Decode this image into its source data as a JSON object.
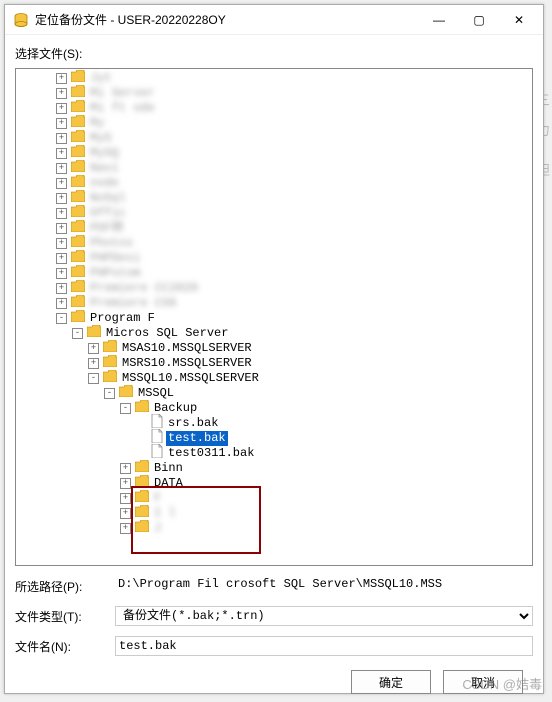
{
  "window": {
    "title": "定位备份文件 - USER-20220228OY",
    "min": "—",
    "max": "▢",
    "close": "✕"
  },
  "labels": {
    "select_file": "选择文件(S):",
    "selected_path": "所选路径(P):",
    "file_type": "文件类型(T):",
    "file_name": "文件名(N):"
  },
  "tree": [
    {
      "indent": 40,
      "exp": "+",
      "type": "folder",
      "label": "Jyt",
      "blur": true
    },
    {
      "indent": 40,
      "exp": "+",
      "type": "folder",
      "label": "Mi         Server",
      "blur": true
    },
    {
      "indent": 40,
      "exp": "+",
      "type": "folder",
      "label": "Mi   ft     ode",
      "blur": true
    },
    {
      "indent": 40,
      "exp": "+",
      "type": "folder",
      "label": "My",
      "blur": true
    },
    {
      "indent": 40,
      "exp": "+",
      "type": "folder",
      "label": "MyS",
      "blur": true
    },
    {
      "indent": 40,
      "exp": "+",
      "type": "folder",
      "label": "MySQ",
      "blur": true
    },
    {
      "indent": 40,
      "exp": "+",
      "type": "folder",
      "label": "Navi",
      "blur": true
    },
    {
      "indent": 40,
      "exp": "+",
      "type": "folder",
      "label": "node",
      "blur": true
    },
    {
      "indent": 40,
      "exp": "+",
      "type": "folder",
      "label": "NoSql",
      "blur": true
    },
    {
      "indent": 40,
      "exp": "+",
      "type": "folder",
      "label": "Offic",
      "blur": true
    },
    {
      "indent": 40,
      "exp": "+",
      "type": "folder",
      "label": "PDF转",
      "blur": true
    },
    {
      "indent": 40,
      "exp": "+",
      "type": "folder",
      "label": "Photos",
      "blur": true
    },
    {
      "indent": 40,
      "exp": "+",
      "type": "folder",
      "label": "PHPDesi",
      "blur": true
    },
    {
      "indent": 40,
      "exp": "+",
      "type": "folder",
      "label": "PHPstom",
      "blur": true
    },
    {
      "indent": 40,
      "exp": "+",
      "type": "folder",
      "label": "Premiere    CC2020",
      "blur": true
    },
    {
      "indent": 40,
      "exp": "+",
      "type": "folder",
      "label": "Premiere    CS6",
      "blur": true
    },
    {
      "indent": 40,
      "exp": "-",
      "type": "folder",
      "label": "Program F"
    },
    {
      "indent": 56,
      "exp": "-",
      "type": "folder",
      "label": "Micros    SQL Server"
    },
    {
      "indent": 72,
      "exp": "+",
      "type": "folder",
      "label": "MSAS10.MSSQLSERVER"
    },
    {
      "indent": 72,
      "exp": "+",
      "type": "folder",
      "label": "MSRS10.MSSQLSERVER"
    },
    {
      "indent": 72,
      "exp": "-",
      "type": "folder",
      "label": "MSSQL10.MSSQLSERVER"
    },
    {
      "indent": 88,
      "exp": "-",
      "type": "folder",
      "label": "MSSQL"
    },
    {
      "indent": 104,
      "exp": "-",
      "type": "folder",
      "label": "Backup"
    },
    {
      "indent": 120,
      "exp": "",
      "type": "file",
      "label": "srs.bak"
    },
    {
      "indent": 120,
      "exp": "",
      "type": "file",
      "label": "test.bak",
      "selected": true
    },
    {
      "indent": 120,
      "exp": "",
      "type": "file",
      "label": "test0311.bak"
    },
    {
      "indent": 104,
      "exp": "+",
      "type": "folder",
      "label": "Binn"
    },
    {
      "indent": 104,
      "exp": "+",
      "type": "folder",
      "label": "DATA"
    },
    {
      "indent": 104,
      "exp": "+",
      "type": "folder",
      "label": "F",
      "blur": true
    },
    {
      "indent": 104,
      "exp": "+",
      "type": "folder",
      "label": "I      l",
      "blur": true
    },
    {
      "indent": 104,
      "exp": "+",
      "type": "folder",
      "label": "J",
      "blur": true
    }
  ],
  "form": {
    "selected_path": "D:\\Program Fil    crosoft SQL Server\\MSSQL10.MSS",
    "file_type": "备份文件(*.bak;*.trn)",
    "file_name": "test.bak"
  },
  "buttons": {
    "ok": "确定",
    "cancel": "取消"
  },
  "watermark": "CSDN @姞毒",
  "ghost": {
    "a": "三",
    "b": "力",
    "c": "妲"
  }
}
